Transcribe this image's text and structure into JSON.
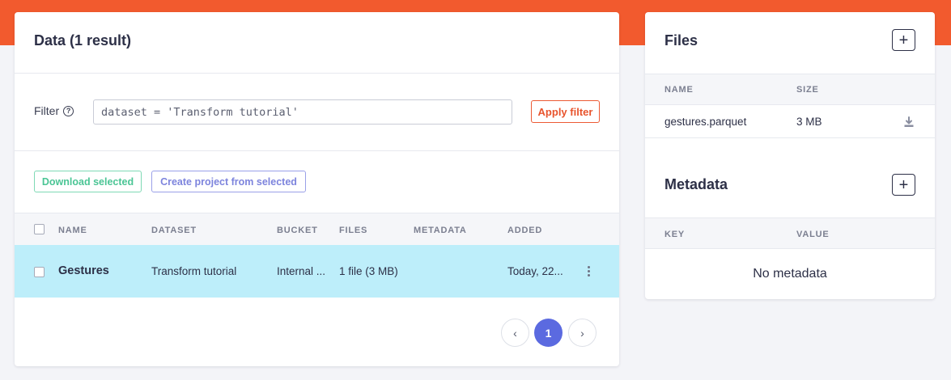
{
  "data_panel": {
    "title": "Data (1 result)",
    "filter_label": "Filter",
    "filter_value": "dataset = 'Transform tutorial'",
    "apply_label": "Apply filter",
    "download_label": "Download selected",
    "create_label": "Create project from selected",
    "columns": [
      "NAME",
      "DATASET",
      "BUCKET",
      "FILES",
      "METADATA",
      "ADDED"
    ],
    "rows": [
      {
        "name": "Gestures",
        "dataset": "Transform tutorial",
        "bucket": "Internal ...",
        "files": "1 file (3 MB)",
        "metadata": "",
        "added": "Today, 22..."
      }
    ],
    "pagination": {
      "prev": "‹",
      "current": "1",
      "next": "›"
    }
  },
  "files_panel": {
    "title": "Files",
    "columns": [
      "NAME",
      "SIZE"
    ],
    "files": [
      {
        "name": "gestures.parquet",
        "size": "3 MB"
      }
    ],
    "metadata_title": "Metadata",
    "metadata_columns": [
      "KEY",
      "VALUE"
    ],
    "empty_text": "No metadata",
    "add_symbol": "+"
  },
  "colors": {
    "brand": "#f25a2e",
    "accent": "#5b6ae0",
    "selected_row": "#bdeefa"
  }
}
